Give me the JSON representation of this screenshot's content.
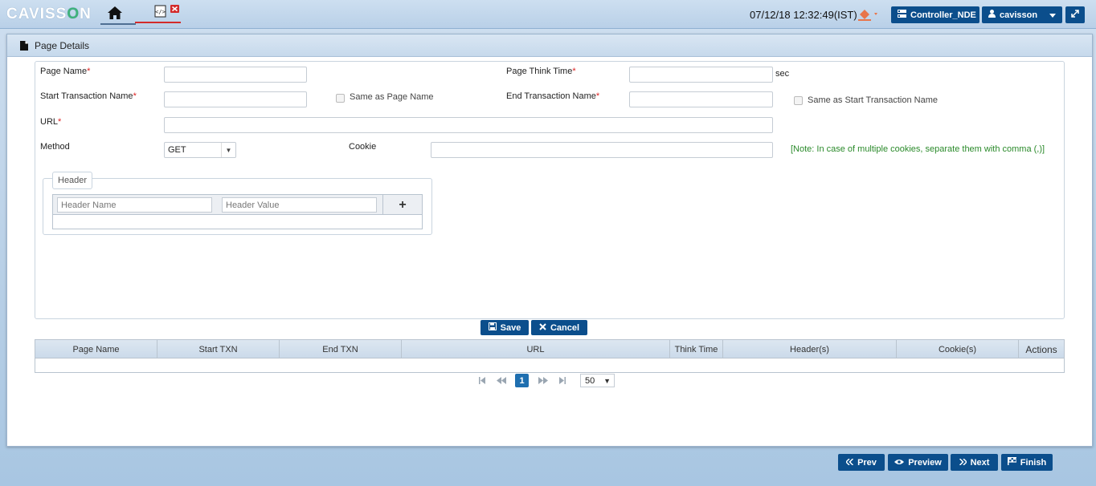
{
  "app": {
    "logo_text_left": "CAVISS",
    "logo_text_o": "O",
    "logo_text_right": "N",
    "datetime": "07/12/18 12:32:49(IST)",
    "controller_label": "Controller_NDE",
    "user_label": "cavisson"
  },
  "panel": {
    "title": "Page Details"
  },
  "form": {
    "page_name_label": "Page Name",
    "page_think_time_label": "Page Think Time",
    "sec_label": "sec",
    "start_txn_label": "Start Transaction Name",
    "same_as_page_label": "Same as Page Name",
    "end_txn_label": "End Transaction Name",
    "same_as_start_label": "Same as Start Transaction Name",
    "url_label": "URL",
    "method_label": "Method",
    "method_value": "GET",
    "cookie_label": "Cookie",
    "cookie_note": "[Note: In case of multiple cookies, separate them with comma (,)]",
    "required_mark": "*",
    "header_legend": "Header",
    "header_name_placeholder": "Header Name",
    "header_value_placeholder": "Header Value",
    "add_symbol": "+"
  },
  "actions": {
    "save_label": "Save",
    "cancel_label": "Cancel"
  },
  "table": {
    "columns": [
      "Page Name",
      "Start TXN",
      "End TXN",
      "URL",
      "Think Time",
      "Header(s)",
      "Cookie(s)",
      "Actions"
    ]
  },
  "pager": {
    "current_page": "1",
    "rows_per_page": "50"
  },
  "footer": {
    "prev_label": "Prev",
    "preview_label": "Preview",
    "next_label": "Next",
    "finish_label": "Finish"
  },
  "colors": {
    "primary_button": "#0b4e8c",
    "required": "#dd2222",
    "note": "#2a8a2a"
  }
}
